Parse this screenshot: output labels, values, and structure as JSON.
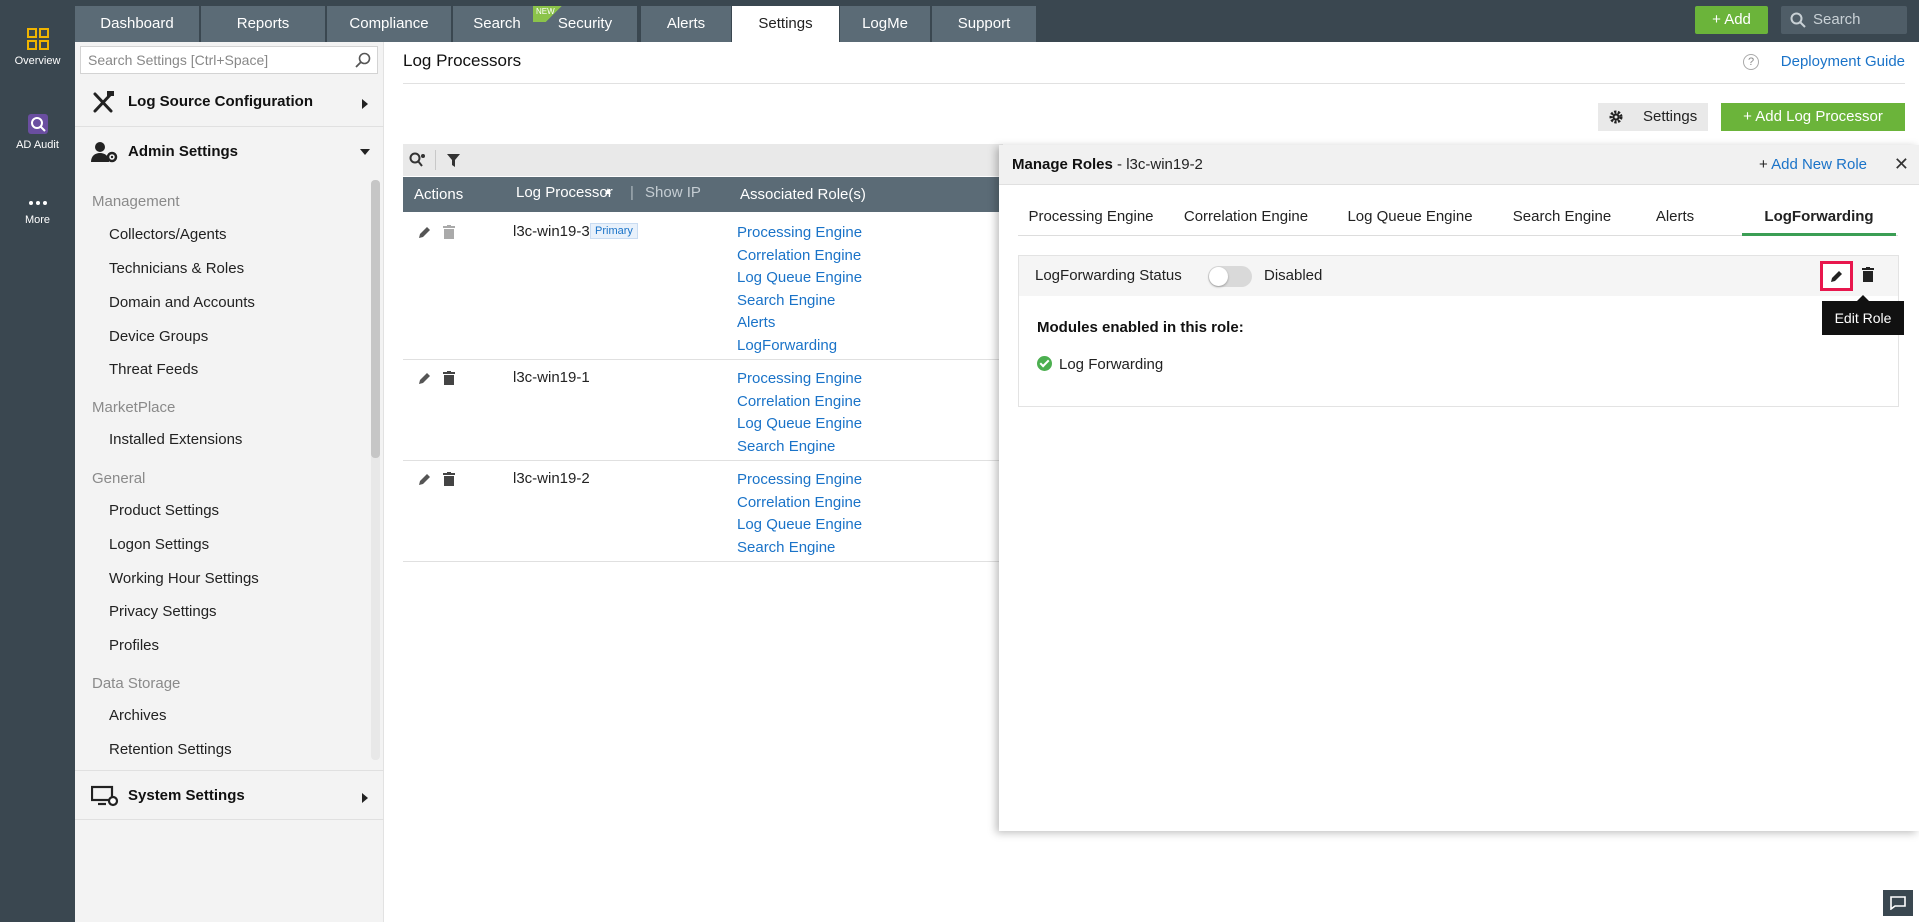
{
  "appbar": {
    "items": [
      {
        "label": "Overview"
      },
      {
        "label": "AD Audit"
      },
      {
        "label": "More"
      }
    ]
  },
  "nav": {
    "tabs": [
      "Dashboard",
      "Reports",
      "Compliance",
      "Search",
      "Security",
      "Alerts",
      "Settings",
      "LogMe",
      "Support"
    ],
    "active": "Settings",
    "new_badge": "NEW",
    "add_label": "Add",
    "search_placeholder": "Search"
  },
  "sidebar": {
    "search_placeholder": "Search Settings [Ctrl+Space]",
    "log_source_config": "Log Source Configuration",
    "admin_settings": "Admin Settings",
    "groups": [
      {
        "label": "Management",
        "items": [
          "Collectors/Agents",
          "Technicians & Roles",
          "Domain and Accounts",
          "Device Groups",
          "Threat Feeds"
        ]
      },
      {
        "label": "MarketPlace",
        "items": [
          "Installed Extensions"
        ]
      },
      {
        "label": "General",
        "items": [
          "Product Settings",
          "Logon Settings",
          "Working Hour Settings",
          "Privacy Settings",
          "Profiles"
        ]
      },
      {
        "label": "Data Storage",
        "items": [
          "Archives",
          "Retention Settings"
        ]
      }
    ],
    "system_settings": "System Settings"
  },
  "main": {
    "title": "Log Processors",
    "deployment_guide": "Deployment Guide",
    "settings_btn": "Settings",
    "add_btn": "Add Log Processor",
    "table": {
      "headers": {
        "actions": "Actions",
        "processor": "Log Processor",
        "show_ip": "Show IP",
        "roles": "Associated Role(s)"
      },
      "primary_badge": "Primary",
      "rows": [
        {
          "name": "l3c-win19-3",
          "roles": [
            "Processing Engine",
            "Correlation Engine",
            "Log Queue Engine",
            "Search Engine",
            "Alerts",
            "LogForwarding"
          ]
        },
        {
          "name": "l3c-win19-1",
          "roles": [
            "Processing Engine",
            "Correlation Engine",
            "Log Queue Engine",
            "Search Engine"
          ]
        },
        {
          "name": "l3c-win19-2",
          "roles": [
            "Processing Engine",
            "Correlation Engine",
            "Log Queue Engine",
            "Search Engine"
          ]
        }
      ]
    }
  },
  "panel": {
    "title": "Manage Roles",
    "subtitle": " - l3c-win19-2",
    "add_role": "Add New Role",
    "tabs": [
      "Processing Engine",
      "Correlation Engine",
      "Log Queue Engine",
      "Search Engine",
      "Alerts",
      "LogForwarding"
    ],
    "active_tab": "LogForwarding",
    "status_label": "LogForwarding Status",
    "status_value": "Disabled",
    "tooltip": "Edit Role",
    "modules_title": "Modules enabled in this role:",
    "modules": [
      "Log Forwarding"
    ]
  },
  "colors": {
    "accent_green": "#6bb43a",
    "link_blue": "#1a73c8",
    "highlight": "#e8174d",
    "nav_bg": "#3a4750"
  }
}
